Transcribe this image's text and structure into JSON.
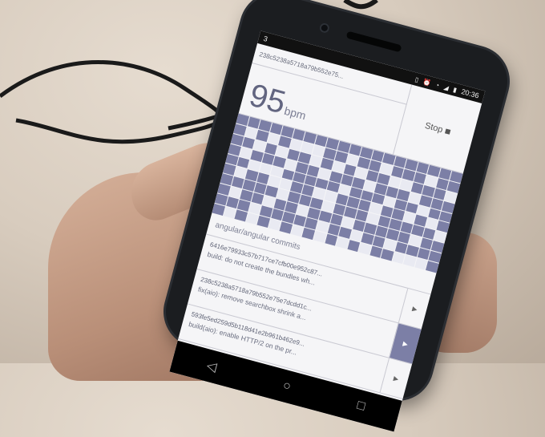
{
  "status_bar": {
    "badge": "3",
    "time": "20:36"
  },
  "header": {
    "current_hash": "238c5238a5718a79b552e75...",
    "bpm_value": "95",
    "bpm_unit": "bpm",
    "stop_label": "Stop"
  },
  "repo_label": "angular/angular commits",
  "commits": [
    {
      "hash": "6416e79933c57b717ce7cfb00e952c87...",
      "message": "build: do not create the bundles wh...",
      "active": false
    },
    {
      "hash": "238c5238a5718a79b552e75e7dcdd1c...",
      "message": "fix(aio): remove searchbox shrink a...",
      "active": true
    },
    {
      "hash": "593fe5ed259d5b118d41e2b961b462e9...",
      "message": "build(aio): enable HTTP/2 on the pr...",
      "active": false
    }
  ],
  "grid_pattern": [
    "11111111111111111111",
    "10101000110110111011",
    "11010110101011001110",
    "10111011011101110111",
    "11000111110111011011",
    "10110011001110110101",
    "11111011101110111110",
    "10110110111011111011",
    "11101111101101101111",
    "10101010101010110001"
  ],
  "nav": {
    "back_icon": "◁",
    "home_icon": "○",
    "recents_icon": "□"
  },
  "colors": {
    "accent": "#7c7fa6",
    "cell_off": "#e9eaf2",
    "background": "#f5f5f7"
  }
}
